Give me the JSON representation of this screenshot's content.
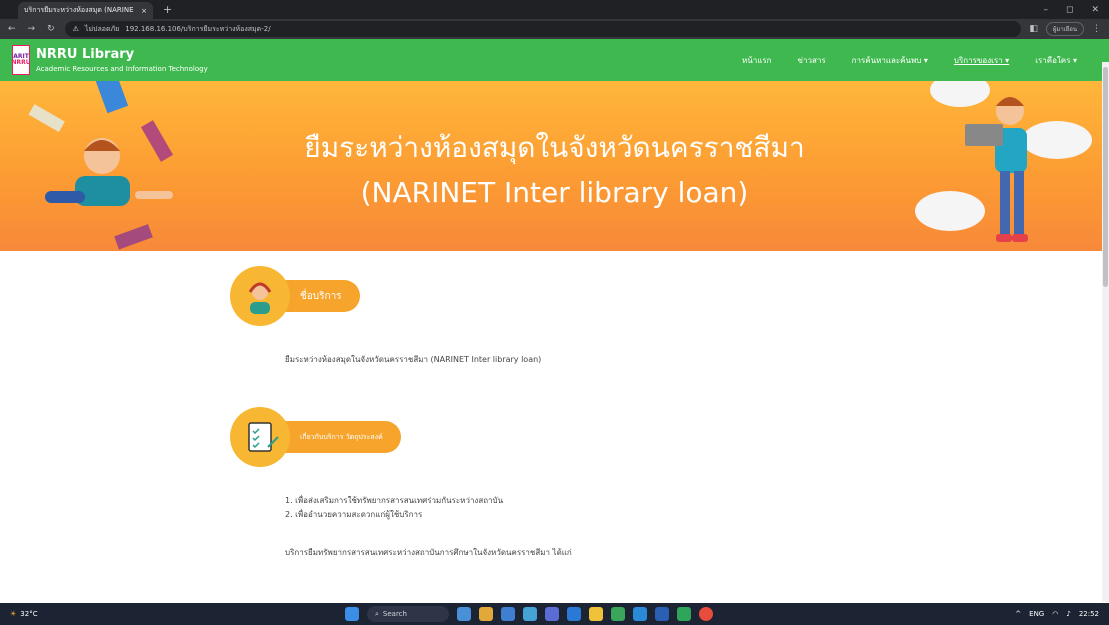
{
  "browser": {
    "tab_title": "บริการยืมระหว่างห้องสมุด (NARINE",
    "tab_close": "×",
    "new_tab": "+",
    "not_secure": "ไม่ปลอดภัย",
    "url": "192.168.16.106/บริการยืมระหว่างห้องสมุด-2/",
    "profile_label": "ผู้มาเยือน"
  },
  "site": {
    "logo_mark": "ARIT",
    "logo_sub": "NRRU",
    "name": "NRRU Library",
    "tagline": "Academic Resources and Information Technology",
    "menu": [
      {
        "label": "หน้าแรก"
      },
      {
        "label": "ข่าวสาร"
      },
      {
        "label": "การค้นหาและค้นพบ ▾"
      },
      {
        "label": "บริการของเรา ▾"
      },
      {
        "label": "เราคือใคร ▾"
      }
    ]
  },
  "banner": {
    "title_line1": "ยืมระหว่างห้องสมุดในจังหวัดนครราชสีมา",
    "title_line2": "(NARINET Inter library loan)"
  },
  "sections": {
    "service_name": {
      "heading": "ชื่อบริการ",
      "text": "ยืมระหว่างห้องสมุดในจังหวัดนครราชสีมา (NARINET Inter library loan)"
    },
    "about": {
      "heading": "เกี่ยวกับบริการ วัตถุประสงค์",
      "items": [
        "1. เพื่อส่งเสริมการใช้ทรัพยากรสารสนเทศร่วมกันระหว่างสถาบัน",
        "2. เพื่ออำนวยความสะดวกแก่ผู้ใช้บริการ"
      ],
      "text": "บริการยืมทรัพยากรสารสนเทศระหว่างสถาบันการศึกษาในจังหวัดนครราชสีมา ได้แก่"
    }
  },
  "taskbar": {
    "temp": "32°C",
    "search_label": "Search",
    "lang": "ENG",
    "time": "22:52"
  }
}
